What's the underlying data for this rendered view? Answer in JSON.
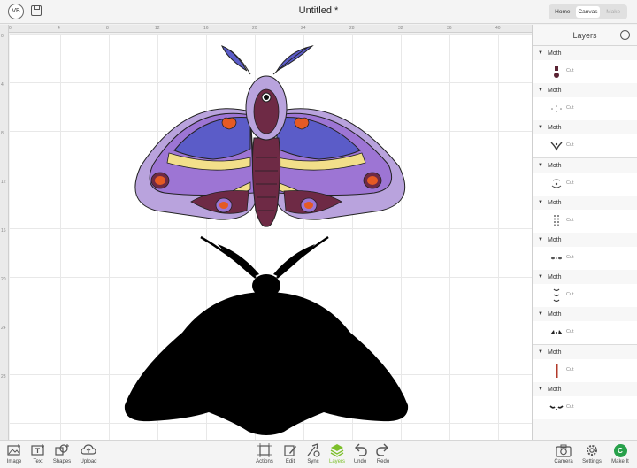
{
  "header": {
    "avatar_initials": "VB",
    "title": "Untitled *",
    "modes": [
      {
        "label": "Home",
        "state": "normal"
      },
      {
        "label": "Canvas",
        "state": "active"
      },
      {
        "label": "Make",
        "state": "disabled"
      }
    ]
  },
  "rulers": {
    "top": [
      "0",
      "4",
      "8",
      "12",
      "16",
      "20",
      "24",
      "28",
      "32",
      "36",
      "40"
    ],
    "left": [
      "0",
      "4",
      "8",
      "12",
      "16",
      "20",
      "24",
      "28"
    ]
  },
  "layers_panel": {
    "title": "Layers",
    "groups": [
      {
        "name": "Moth",
        "operation": "Cut",
        "color": "#5a2333"
      },
      {
        "name": "Moth",
        "operation": "Cut",
        "color": "#7a7a7a"
      },
      {
        "name": "Moth",
        "operation": "Cut",
        "color": "#3a3a3a"
      },
      {
        "name": "Moth",
        "operation": "Cut",
        "color": "#4a4a4a"
      },
      {
        "name": "Moth",
        "operation": "Cut",
        "color": "#444444"
      },
      {
        "name": "Moth",
        "operation": "Cut",
        "color": "#555555"
      },
      {
        "name": "Moth",
        "operation": "Cut",
        "color": "#333333"
      },
      {
        "name": "Moth",
        "operation": "Cut",
        "color": "#222222"
      },
      {
        "name": "Moth",
        "operation": "Cut",
        "color": "#b23a2a"
      },
      {
        "name": "Moth",
        "operation": "Cut",
        "color": "#222222"
      }
    ]
  },
  "toolbar": {
    "left": [
      {
        "label": "Image",
        "icon": "image-icon"
      },
      {
        "label": "Text",
        "icon": "text-icon"
      },
      {
        "label": "Shapes",
        "icon": "shapes-icon"
      },
      {
        "label": "Upload",
        "icon": "upload-icon"
      }
    ],
    "center": [
      {
        "label": "Actions",
        "icon": "actions-icon",
        "active": false
      },
      {
        "label": "Edit",
        "icon": "edit-icon",
        "active": false
      },
      {
        "label": "Sync",
        "icon": "sync-icon",
        "active": false
      },
      {
        "label": "Layers",
        "icon": "layers-icon",
        "active": true
      },
      {
        "label": "Undo",
        "icon": "undo-icon",
        "active": false
      },
      {
        "label": "Redo",
        "icon": "redo-icon",
        "active": false
      }
    ],
    "right": [
      {
        "label": "Camera",
        "icon": "camera-icon"
      },
      {
        "label": "Settings",
        "icon": "gear-icon"
      },
      {
        "label": "Make It",
        "icon": "make-it-icon"
      }
    ]
  },
  "colors": {
    "accent_green": "#7cbf2a",
    "make_it_green": "#27a04a",
    "moth_purple_light": "#b9a3dd",
    "moth_purple": "#9d75d4",
    "moth_blue": "#5b5cc8",
    "moth_yellow": "#f2df8a",
    "moth_orange": "#e55a24",
    "moth_maroon": "#6e2a45",
    "silhouette": "#000000"
  }
}
